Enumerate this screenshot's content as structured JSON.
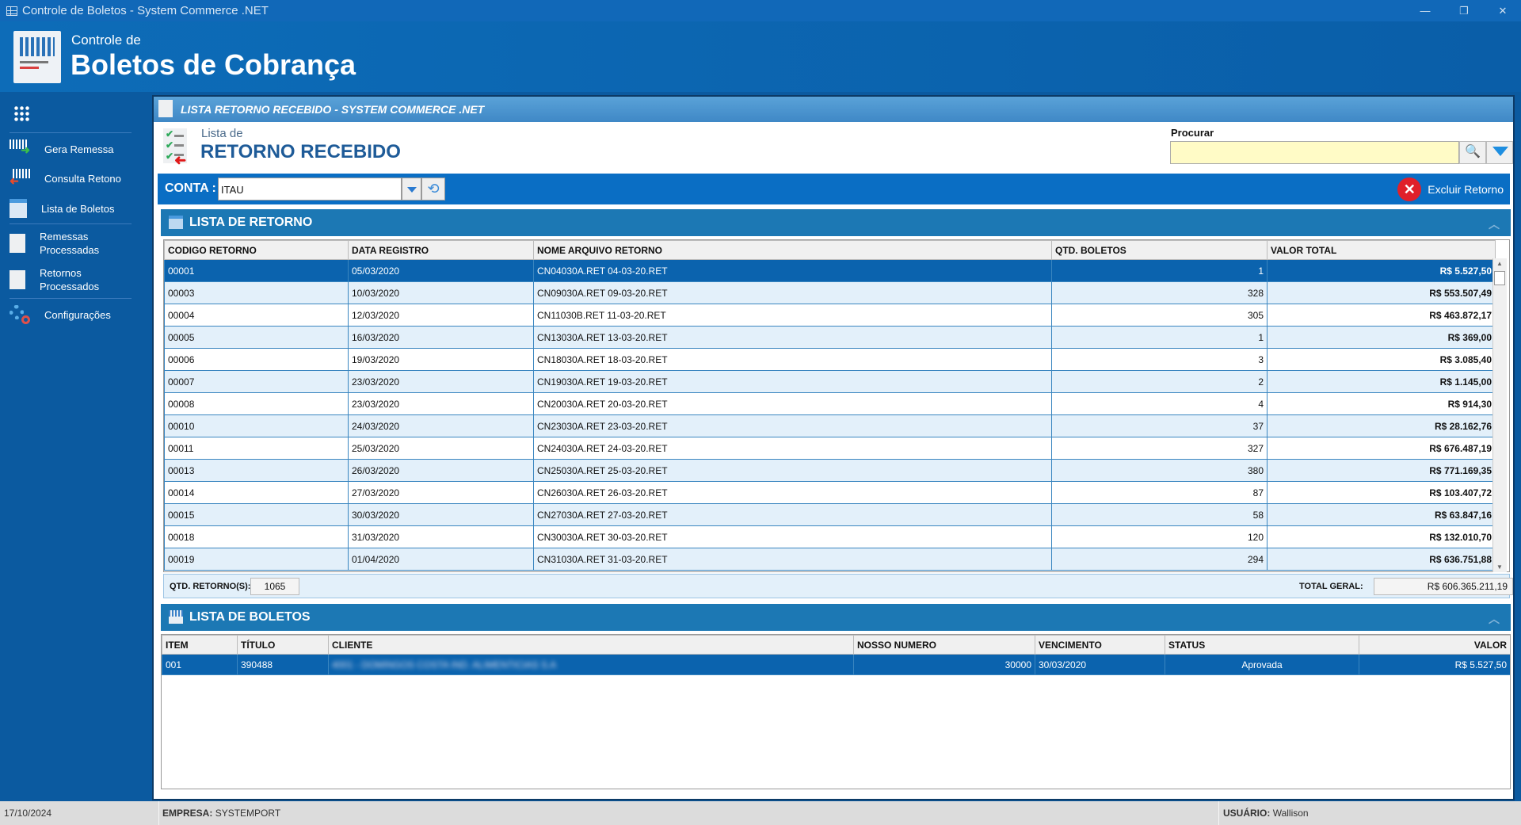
{
  "window": {
    "title": "Controle de Boletos - System Commerce .NET",
    "minimize": "—",
    "restore": "❐",
    "close": "✕"
  },
  "header": {
    "subtitle": "Controle de",
    "title": "Boletos de Cobrança"
  },
  "sidebar": {
    "items": [
      {
        "label": "Gera Remessa",
        "icon": "barcode-send-icon"
      },
      {
        "label": "Consulta Retono",
        "icon": "barcode-receive-icon"
      },
      {
        "label": "Lista de Boletos",
        "icon": "table-icon"
      },
      {
        "label": "Remessas Processadas",
        "icon": "checklist-send-icon"
      },
      {
        "label": "Retornos Processados",
        "icon": "checklist-return-icon"
      },
      {
        "label": "Configurações",
        "icon": "gears-icon"
      }
    ]
  },
  "panel": {
    "title": "LISTA RETORNO RECEBIDO -  SYSTEM COMMERCE .NET",
    "subtitle": "Lista de",
    "heading": "RETORNO RECEBIDO"
  },
  "search": {
    "label": "Procurar",
    "value": ""
  },
  "conta": {
    "label": "CONTA :",
    "value": "ITAU",
    "delete_label": "Excluir Retorno"
  },
  "retornos": {
    "title": "LISTA DE RETORNO",
    "columns": [
      "CODIGO RETORNO",
      "DATA REGISTRO",
      "NOME ARQUIVO RETORNO",
      "QTD. BOLETOS",
      "VALOR TOTAL"
    ],
    "rows": [
      [
        "00001",
        "05/03/2020",
        "CN04030A.RET 04-03-20.RET",
        "1",
        "R$ 5.527,50"
      ],
      [
        "00003",
        "10/03/2020",
        "CN09030A.RET 09-03-20.RET",
        "328",
        "R$ 553.507,49"
      ],
      [
        "00004",
        "12/03/2020",
        "CN11030B.RET 11-03-20.RET",
        "305",
        "R$ 463.872,17"
      ],
      [
        "00005",
        "16/03/2020",
        "CN13030A.RET 13-03-20.RET",
        "1",
        "R$ 369,00"
      ],
      [
        "00006",
        "19/03/2020",
        "CN18030A.RET 18-03-20.RET",
        "3",
        "R$ 3.085,40"
      ],
      [
        "00007",
        "23/03/2020",
        "CN19030A.RET 19-03-20.RET",
        "2",
        "R$ 1.145,00"
      ],
      [
        "00008",
        "23/03/2020",
        "CN20030A.RET 20-03-20.RET",
        "4",
        "R$ 914,30"
      ],
      [
        "00010",
        "24/03/2020",
        "CN23030A.RET 23-03-20.RET",
        "37",
        "R$ 28.162,76"
      ],
      [
        "00011",
        "25/03/2020",
        "CN24030A.RET 24-03-20.RET",
        "327",
        "R$ 676.487,19"
      ],
      [
        "00013",
        "26/03/2020",
        "CN25030A.RET 25-03-20.RET",
        "380",
        "R$ 771.169,35"
      ],
      [
        "00014",
        "27/03/2020",
        "CN26030A.RET 26-03-20.RET",
        "87",
        "R$ 103.407,72"
      ],
      [
        "00015",
        "30/03/2020",
        "CN27030A.RET 27-03-20.RET",
        "58",
        "R$ 63.847,16"
      ],
      [
        "00018",
        "31/03/2020",
        "CN30030A.RET 30-03-20.RET",
        "120",
        "R$ 132.010,70"
      ],
      [
        "00019",
        "01/04/2020",
        "CN31030A.RET 31-03-20.RET",
        "294",
        "R$ 636.751,88"
      ]
    ],
    "count_label": "QTD. RETORNO(S):",
    "count": "1065",
    "total_label": "TOTAL GERAL:",
    "total": "R$ 606.365.211,19"
  },
  "boletos": {
    "title": "LISTA DE BOLETOS",
    "columns": [
      "ITEM",
      "TÍTULO",
      "CLIENTE",
      "NOSSO NUMERO",
      "VENCIMENTO",
      "STATUS",
      "VALOR"
    ],
    "rows": [
      [
        "001",
        "390488",
        "4001 - DOMINGOS COSTA IND. ALIMENTICIAS S.A",
        "30000",
        "30/03/2020",
        "Aprovada",
        "R$ 5.527,50"
      ]
    ]
  },
  "statusbar": {
    "date": "17/10/2024",
    "empresa_label": "EMPRESA:",
    "empresa": "SYSTEMPORT",
    "usuario_label": "USUÁRIO:",
    "usuario": "Wallison"
  }
}
